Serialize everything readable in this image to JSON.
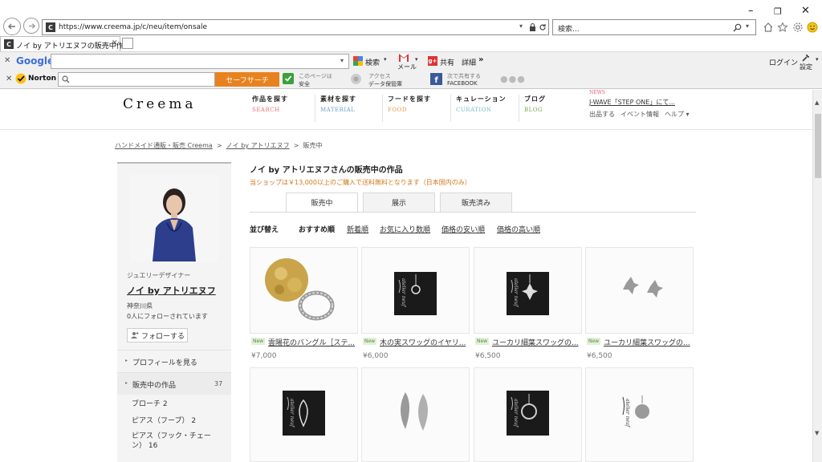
{
  "browser": {
    "url": "https://www.creema.jp/c/neu/item/onsale",
    "search_placeholder": "検索...",
    "tab_title": "ノイ by アトリエヌフの販売中作..."
  },
  "toolbar_google": {
    "brand": "Google",
    "search_label": "検索",
    "mail_label": "メール",
    "share_label": "共有",
    "more_label": "詳細",
    "login_label": "ログイン",
    "settings_label": "設定"
  },
  "toolbar_norton": {
    "brand": "Norton",
    "safe_search_label": "セーフサーチ",
    "page_safe_line1": "このページは",
    "page_safe_line2": "安全",
    "access_line1": "アクセス",
    "access_line2": "データ保管庫",
    "share_line1": "次で共有する",
    "share_line2": "FACEBOOK"
  },
  "site": {
    "logo": "Creema",
    "nav": [
      {
        "label": "作品を探す",
        "sub": "SEARCH",
        "color": "#e8707c"
      },
      {
        "label": "素材を探す",
        "sub": "MATERIAL",
        "color": "#6aa4c8"
      },
      {
        "label": "フードを探す",
        "sub": "FOOD",
        "color": "#e89a4a"
      },
      {
        "label": "キュレーション",
        "sub": "CURATION",
        "color": "#7ac0c8"
      },
      {
        "label": "ブログ",
        "sub": "BLOG",
        "color": "#7aa84a"
      }
    ],
    "news_label": "NEWS",
    "news_text": "J-WAVE「STEP ONE」にて...",
    "util_links": [
      "出品する",
      "イベント情報",
      "ヘルプ ▾"
    ]
  },
  "breadcrumb": [
    "ハンドメイド通販・販売 Creema",
    "ノイ by アトリエヌフ",
    "販売中"
  ],
  "profile": {
    "role": "ジュエリーデザイナー",
    "name": "ノイ by アトリエヌフ",
    "location": "神奈川県",
    "followers": "0人にフォローされています",
    "follow_button": "フォローする",
    "menu": [
      {
        "label": "プロフィールを見る",
        "count": ""
      },
      {
        "label": "販売中の作品",
        "count": "37"
      }
    ],
    "categories": [
      "ブローチ 2",
      "ピアス（フープ） 2",
      "ピアス（フック・チェーン） 16"
    ]
  },
  "main": {
    "heading": "ノイ by アトリエヌフさんの販売中の作品",
    "shipping_note": "当ショップは￥13,000以上のご購入で送料無料となります（日本国内のみ）",
    "tabs": [
      "販売中",
      "展示",
      "販売済み"
    ],
    "active_tab": 0,
    "sort_label": "並び替え",
    "sort_options": [
      "おすすめ順",
      "新着順",
      "お気に入り数順",
      "価格の安い順",
      "価格の高い順"
    ]
  },
  "products": [
    {
      "badge": "New",
      "title": "雲陽花のバングル［ステ...",
      "price": "¥7,000"
    },
    {
      "badge": "New",
      "title": "木の実スワッグのイヤリ...",
      "price": "¥6,000"
    },
    {
      "badge": "New",
      "title": "ユーカリ細葉スワッグの...",
      "price": "¥6,500"
    },
    {
      "badge": "New",
      "title": "ユーカリ細葉スワッグの...",
      "price": "¥6,500"
    },
    {
      "badge": "",
      "title": "",
      "price": ""
    },
    {
      "badge": "",
      "title": "",
      "price": ""
    },
    {
      "badge": "",
      "title": "",
      "price": ""
    },
    {
      "badge": "",
      "title": "",
      "price": ""
    }
  ],
  "board_script": "atelier neuf",
  "colors": {
    "accent_orange": "#e8821e",
    "norton_yellow": "#ffc20e",
    "safe_green": "#3aa03a",
    "product_board": "#1a1a1a"
  }
}
